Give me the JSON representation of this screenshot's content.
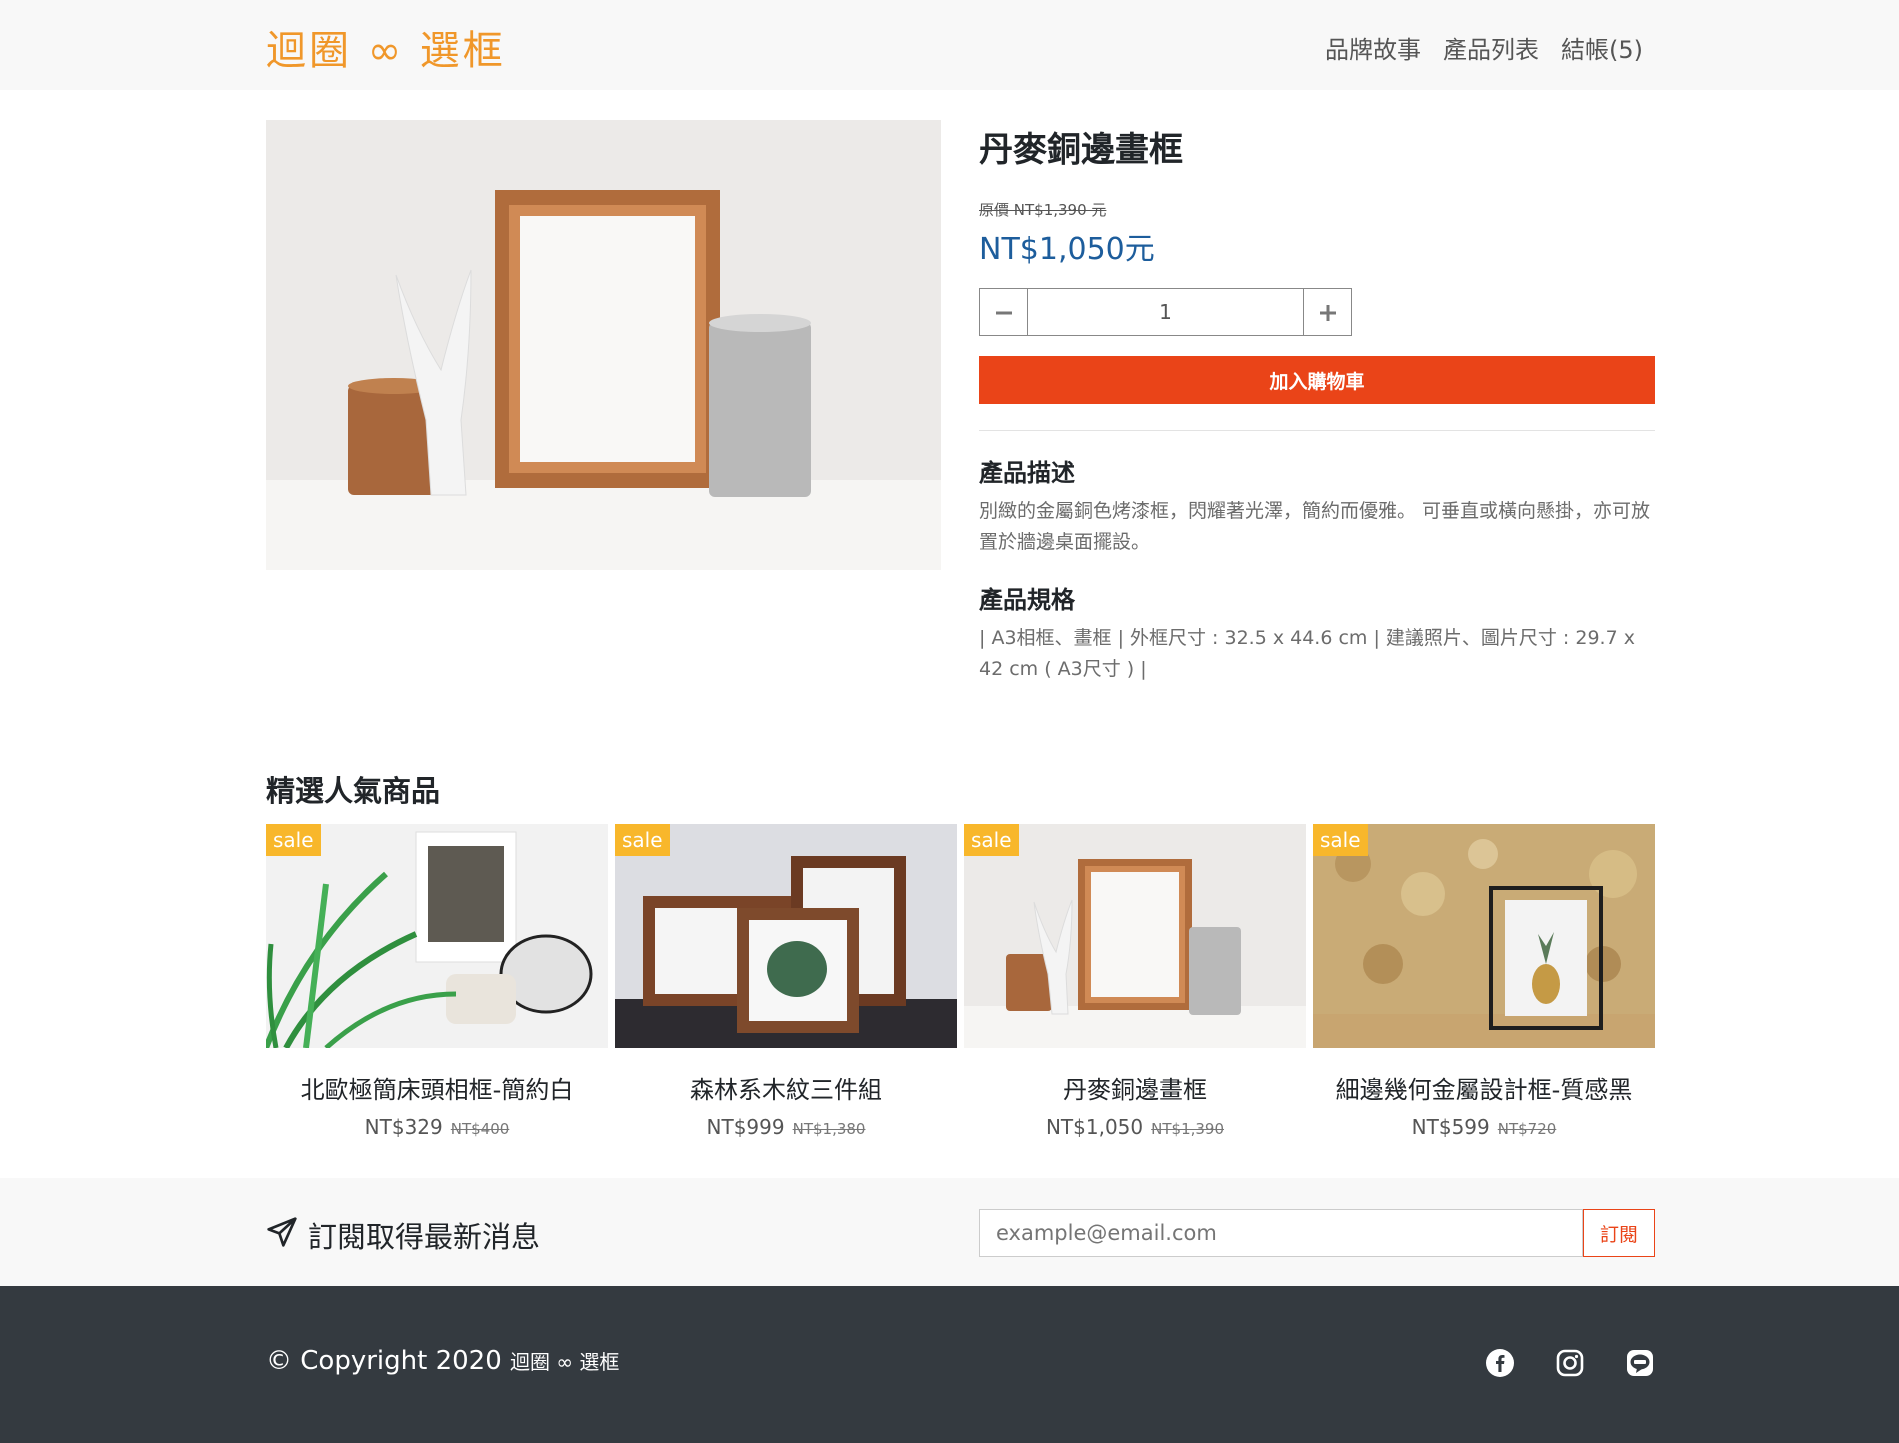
{
  "nav": {
    "brand": "迴圈 ∞ 選框",
    "links": [
      "品牌故事",
      "產品列表",
      "結帳(5)"
    ]
  },
  "product": {
    "title": "丹麥銅邊畫框",
    "original_price": "原價 NT$1,390 元",
    "price": "NT$1,050元",
    "quantity": "1",
    "add_to_cart": "加入購物車",
    "desc_heading": "產品描述",
    "desc_text": "別緻的金屬銅色烤漆框，閃耀著光澤，簡約而優雅。 可垂直或橫向懸掛，亦可放置於牆邊桌面擺設。",
    "spec_heading": "產品規格",
    "spec_text": "| A3相框、畫框 | 外框尺寸 : 32.5 x 44.6 cm | 建議照片、圖片尺寸 : 29.7 x 42 cm ( A3尺寸 ) |"
  },
  "featured": {
    "title": "精選人氣商品",
    "items": [
      {
        "badge": "sale",
        "name": "北歐極簡床頭相框-簡約白",
        "price": "NT$329",
        "old": "NT$400"
      },
      {
        "badge": "sale",
        "name": "森林系木紋三件組",
        "price": "NT$999",
        "old": "NT$1,380"
      },
      {
        "badge": "sale",
        "name": "丹麥銅邊畫框",
        "price": "NT$1,050",
        "old": "NT$1,390"
      },
      {
        "badge": "sale",
        "name": "細邊幾何金屬設計框-質感黑",
        "price": "NT$599",
        "old": "NT$720"
      }
    ]
  },
  "subscribe": {
    "title": "訂閱取得最新消息",
    "placeholder": "example@email.com",
    "button": "訂閱"
  },
  "footer": {
    "copyright": "© Copyright 2020",
    "brand": "迴圈 ∞ 選框"
  },
  "colors": {
    "brand": "#f0972a",
    "price_blue": "#1d5d9c",
    "cta": "#ea4418",
    "sale_badge": "#f8b72b",
    "footer_bg": "#343a40"
  },
  "icons": [
    "minus-icon",
    "plus-icon",
    "paper-plane-icon",
    "facebook-icon",
    "instagram-icon",
    "line-icon"
  ]
}
